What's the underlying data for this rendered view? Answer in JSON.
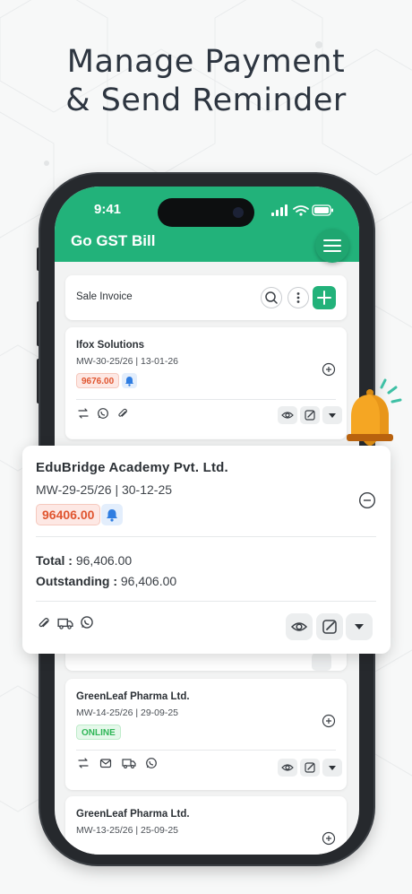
{
  "headline": {
    "line1": "Manage Payment",
    "line2": "& Send Reminder"
  },
  "status_bar": {
    "time": "9:41"
  },
  "app": {
    "title": "Go GST Bill"
  },
  "section": {
    "title": "Sale Invoice"
  },
  "invoices": [
    {
      "name": "Ifox Solutions",
      "meta": "MW-30-25/26 | 13-01-26",
      "amount": "9676.00"
    },
    {
      "name": "GreenLeaf Pharma Ltd.",
      "meta": "MW-14-25/26 | 29-09-25",
      "status": "ONLINE"
    },
    {
      "name": "GreenLeaf Pharma Ltd.",
      "meta": "MW-13-25/26 | 25-09-25"
    }
  ],
  "popup": {
    "name": "EduBridge Academy Pvt. Ltd.",
    "meta": "MW-29-25/26 | 30-12-25",
    "amount": "96406.00",
    "total_label": "Total :",
    "total_value": "96,406.00",
    "outstanding_label": "Outstanding :",
    "outstanding_value": "96,406.00"
  },
  "colors": {
    "brand_green": "#22b27a",
    "amount_red": "#e0552f",
    "online_green": "#2fb657",
    "bell_orange": "#f5a623"
  }
}
